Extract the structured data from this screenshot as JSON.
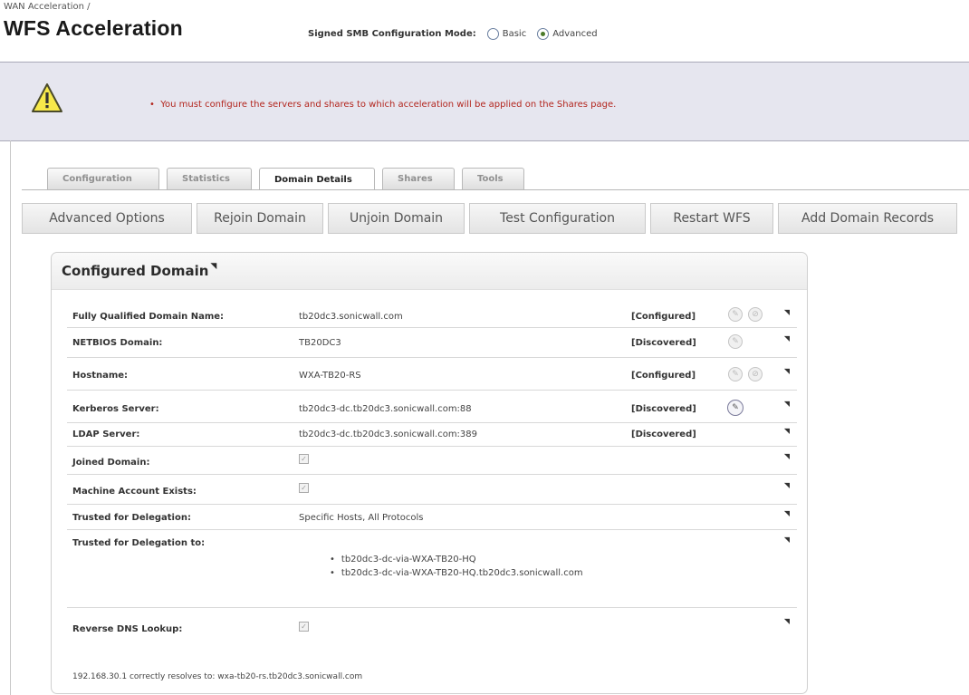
{
  "breadcrumb": "WAN Acceleration /",
  "page_title": "WFS Acceleration",
  "mode": {
    "label": "Signed SMB Configuration Mode:",
    "options": [
      "Basic",
      "Advanced"
    ],
    "selected": "Advanced"
  },
  "alert": {
    "message": "You must configure the servers and shares to which acceleration will be applied on the Shares page."
  },
  "tabs": [
    "Configuration",
    "Statistics",
    "Domain Details",
    "Shares",
    "Tools"
  ],
  "active_tab": "Domain Details",
  "buttons": [
    "Advanced Options",
    "Rejoin Domain",
    "Unjoin Domain",
    "Test Configuration",
    "Restart WFS",
    "Add Domain Records"
  ],
  "panel": {
    "title": "Configured Domain",
    "rows": [
      {
        "label": "Fully Qualified Domain Name:",
        "value": "tb20dc3.sonicwall.com",
        "status": "[Configured]"
      },
      {
        "label": "NETBIOS Domain:",
        "value": "TB20DC3",
        "status": "[Discovered]"
      },
      {
        "label": "Hostname:",
        "value": "WXA-TB20-RS",
        "status": "[Configured]"
      },
      {
        "label": "Kerberos Server:",
        "value": "tb20dc3-dc.tb20dc3.sonicwall.com:88",
        "status": "[Discovered]"
      },
      {
        "label": "LDAP Server:",
        "value": "tb20dc3-dc.tb20dc3.sonicwall.com:389",
        "status": "[Discovered]"
      },
      {
        "label": "Joined Domain:",
        "checked": true
      },
      {
        "label": "Machine Account Exists:",
        "checked": true
      },
      {
        "label": "Trusted for Delegation:",
        "value": "Specific Hosts, All Protocols"
      },
      {
        "label": "Trusted for Delegation to:",
        "list": [
          "tb20dc3-dc-via-WXA-TB20-HQ",
          "tb20dc3-dc-via-WXA-TB20-HQ.tb20dc3.sonicwall.com"
        ]
      },
      {
        "label": "Reverse DNS Lookup:",
        "checked": true
      }
    ],
    "footer": "192.168.30.1 correctly resolves to: wxa-tb20-rs.tb20dc3.sonicwall.com"
  },
  "icons": {
    "edit": "pencil-icon",
    "delete": "cancel-icon",
    "warning": "warning-triangle-icon",
    "collapse": "corner-triangle-icon"
  },
  "colors": {
    "alert_text": "#b3261e",
    "alert_bg": "#e6e6ef"
  }
}
